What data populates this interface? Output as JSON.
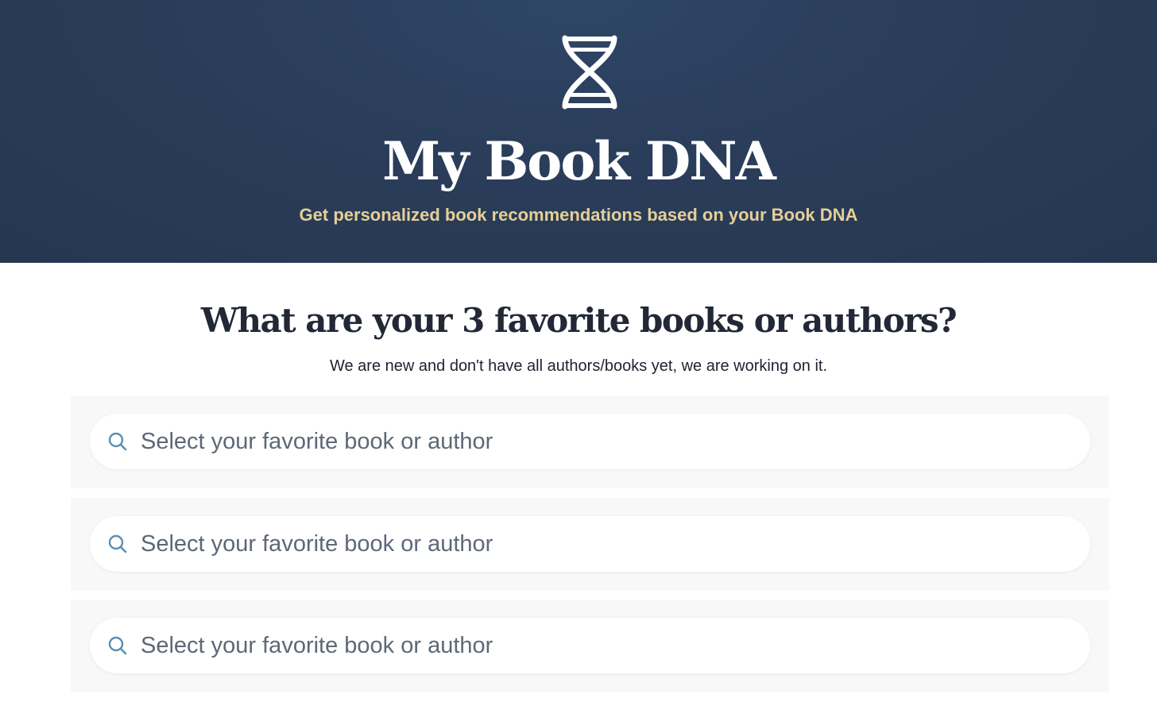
{
  "header": {
    "logo_icon": "dna-helix-icon",
    "title": "My Book DNA",
    "tagline": "Get personalized book recommendations based on your Book DNA",
    "background_color": "#2a3d5a",
    "tagline_color": "#e6cf97"
  },
  "main": {
    "question": "What are your 3 favorite books or authors?",
    "subtitle": "We are new and don't have all authors/books yet, we are working on it.",
    "searches": [
      {
        "icon": "search-icon",
        "placeholder": "Select your favorite book or author",
        "value": ""
      },
      {
        "icon": "search-icon",
        "placeholder": "Select your favorite book or author",
        "value": ""
      },
      {
        "icon": "search-icon",
        "placeholder": "Select your favorite book or author",
        "value": ""
      }
    ]
  }
}
